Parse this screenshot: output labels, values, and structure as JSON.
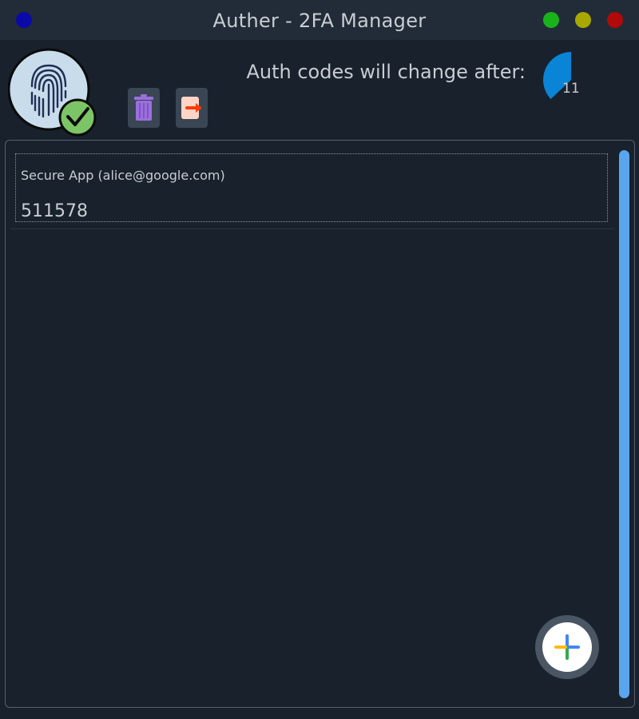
{
  "window": {
    "title": "Auther - 2FA Manager",
    "app_icon": "app-dot-icon",
    "controls": {
      "minimize_color": "#1ab21a",
      "maximize_color": "#a8a800",
      "close_color": "#b00a0a"
    }
  },
  "header": {
    "avatar_icon": "fingerprint-verified-icon",
    "toolbar": [
      {
        "name": "delete",
        "icon": "trash-icon"
      },
      {
        "name": "export",
        "icon": "export-icon"
      }
    ],
    "timer_label": "Auth codes will change after:",
    "timer_value": "11",
    "timer_fraction": 0.37
  },
  "accounts": [
    {
      "name": "Secure App (alice@google.com)",
      "code": "511578"
    }
  ],
  "fab": {
    "icon": "plus-icon"
  },
  "colors": {
    "background": "#18212c",
    "titlebar": "#222c38",
    "accent": "#0a84d6",
    "scrollbar": "#5aa6ee",
    "text": "#c8cdd2"
  }
}
